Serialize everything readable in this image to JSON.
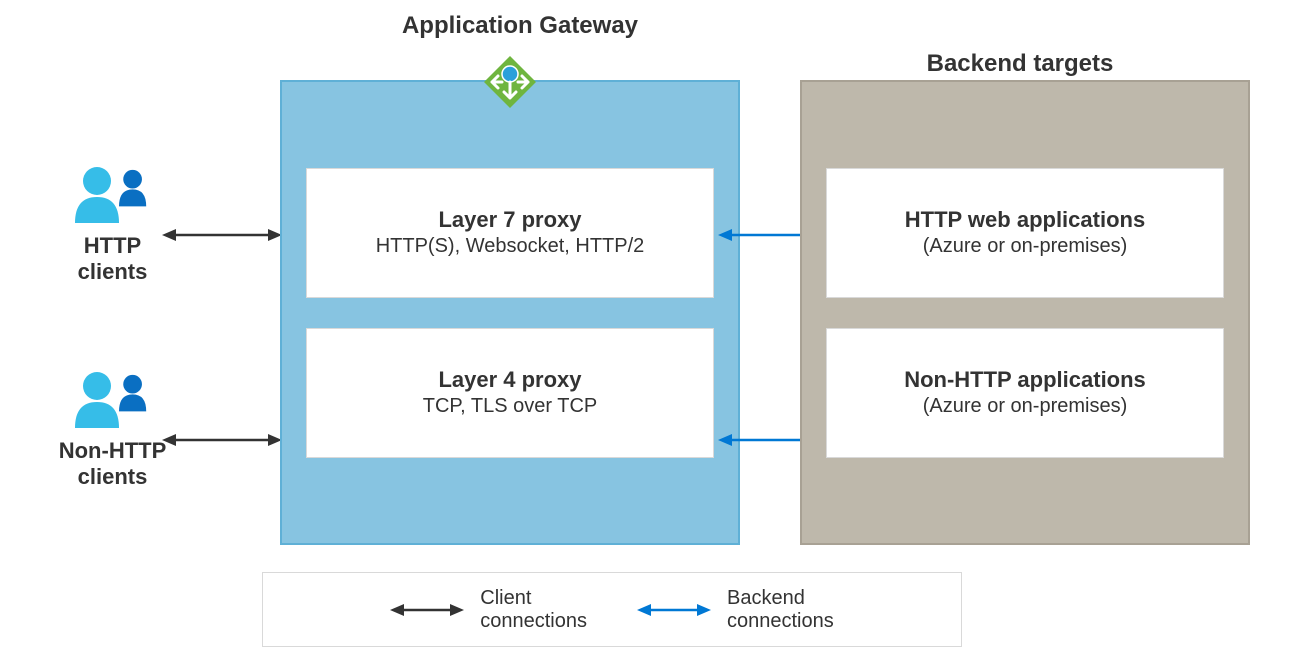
{
  "titles": {
    "gateway": "Application Gateway",
    "backend": "Backend targets"
  },
  "clients": {
    "http": "HTTP\nclients",
    "nonhttp": "Non-HTTP\nclients"
  },
  "gateway": {
    "layer7": {
      "title": "Layer 7 proxy",
      "sub": "HTTP(S), Websocket, HTTP/2"
    },
    "layer4": {
      "title": "Layer 4 proxy",
      "sub": "TCP, TLS over TCP"
    }
  },
  "backend": {
    "http": {
      "title": "HTTP web applications",
      "sub": "(Azure or on-premises)"
    },
    "nonhttp": {
      "title": "Non-HTTP applications",
      "sub": "(Azure or on-premises)"
    }
  },
  "legend": {
    "client": "Client\nconnections",
    "backend": "Backend\nconnections"
  },
  "colors": {
    "gateway_bg": "#87c4e1",
    "backend_bg": "#beb8ab",
    "arrow_client": "#333333",
    "arrow_backend": "#0078d4"
  }
}
